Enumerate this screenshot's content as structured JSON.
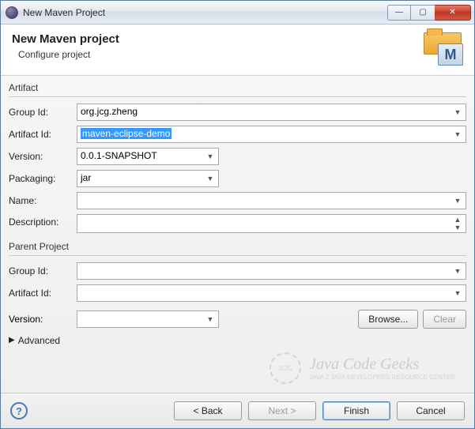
{
  "window": {
    "title": "New Maven Project"
  },
  "header": {
    "title": "New Maven project",
    "subtitle": "Configure project"
  },
  "artifact": {
    "section_label": "Artifact",
    "group_id": {
      "label": "Group Id:",
      "value": "org.jcg.zheng"
    },
    "artifact_id": {
      "label": "Artifact Id:",
      "value": "maven-eclipse-demo"
    },
    "version": {
      "label": "Version:",
      "value": "0.0.1-SNAPSHOT"
    },
    "packaging": {
      "label": "Packaging:",
      "value": "jar"
    },
    "name": {
      "label": "Name:",
      "value": ""
    },
    "description": {
      "label": "Description:",
      "value": ""
    }
  },
  "parent": {
    "section_label": "Parent Project",
    "group_id": {
      "label": "Group Id:",
      "value": ""
    },
    "artifact_id": {
      "label": "Artifact Id:",
      "value": ""
    },
    "version": {
      "label": "Version:",
      "value": ""
    },
    "browse_label": "Browse...",
    "clear_label": "Clear"
  },
  "advanced_label": "Advanced",
  "watermark": {
    "logo": "JCG",
    "line1": "Java Code Geeks",
    "line2": "JAVA 2 JAVA DEVELOPERS RESOURCE CENTER"
  },
  "footer": {
    "back": "< Back",
    "next": "Next >",
    "finish": "Finish",
    "cancel": "Cancel"
  },
  "winbtns": {
    "min": "—",
    "max": "▢",
    "close": "✕"
  }
}
